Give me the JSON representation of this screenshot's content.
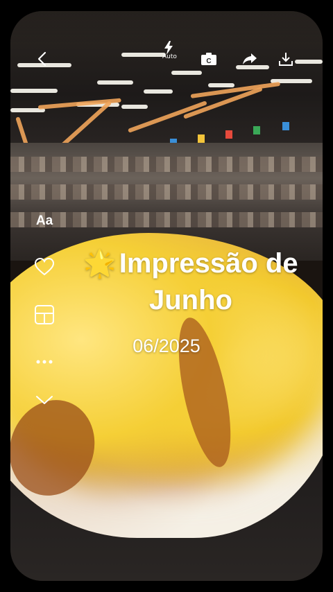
{
  "toolbar": {
    "back_icon": "chevron-left-icon",
    "flash_icon": "flash-icon",
    "flash_label": "Auto",
    "template_icon": "caption-camera-icon",
    "share_icon": "share-arrow-icon",
    "download_icon": "download-icon"
  },
  "side_tools": {
    "text_label": "Aa",
    "like_icon": "heart-icon",
    "layout_icon": "layout-grid-icon",
    "more_icon": "more-dots-icon",
    "collapse_icon": "chevron-down-icon"
  },
  "overlay": {
    "emoji": "🌟",
    "title_line1": "Impressão de",
    "title_line2": "Junho",
    "date": "06/2025"
  },
  "colors": {
    "background": "#000000",
    "text": "#ffffff",
    "bread_yellow": "#f5cf36",
    "bread_crust": "#b05a1e"
  }
}
